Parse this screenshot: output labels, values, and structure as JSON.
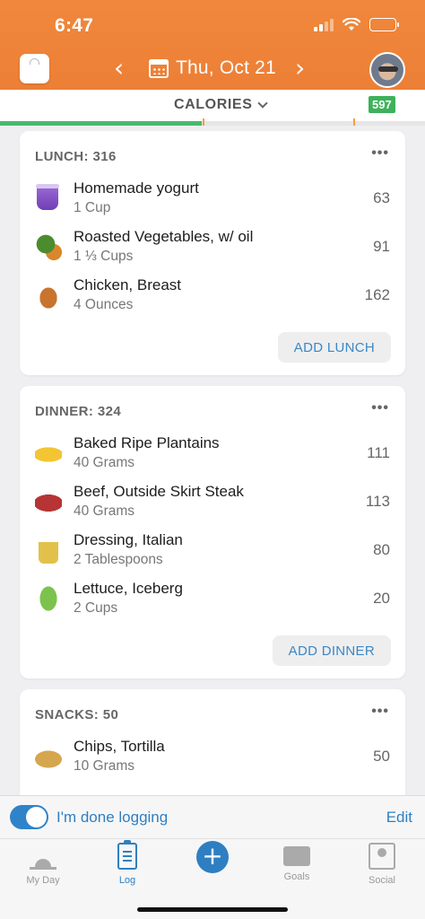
{
  "status_bar": {
    "time": "6:47"
  },
  "header": {
    "date": "Thu, Oct 21",
    "prev_arrow": "‹",
    "next_arrow": "›"
  },
  "metric": {
    "label": "CALORIES",
    "remaining": "597",
    "progress_fraction": 0.475,
    "accent": "#ec7f36",
    "progress_color": "#47b96c"
  },
  "meals": [
    {
      "title": "LUNCH: 316",
      "more": "•••",
      "add_label": "ADD LUNCH",
      "items": [
        {
          "name": "Homemade yogurt",
          "qty": "1 Cup",
          "cal": "63",
          "icon": "yogurt-icon"
        },
        {
          "name": "Roasted Vegetables, w/ oil",
          "qty": "1 ⅓ Cups",
          "cal": "91",
          "icon": "vegetables-icon"
        },
        {
          "name": "Chicken, Breast",
          "qty": "4 Ounces",
          "cal": "162",
          "icon": "chicken-icon"
        }
      ]
    },
    {
      "title": "DINNER: 324",
      "more": "•••",
      "add_label": "ADD DINNER",
      "items": [
        {
          "name": "Baked Ripe Plantains",
          "qty": "40 Grams",
          "cal": "111",
          "icon": "banana-icon"
        },
        {
          "name": "Beef, Outside Skirt Steak",
          "qty": "40 Grams",
          "cal": "113",
          "icon": "steak-icon"
        },
        {
          "name": "Dressing, Italian",
          "qty": "2 Tablespoons",
          "cal": "80",
          "icon": "oil-bottle-icon"
        },
        {
          "name": "Lettuce, Iceberg",
          "qty": "2 Cups",
          "cal": "20",
          "icon": "lettuce-icon"
        }
      ]
    },
    {
      "title": "SNACKS: 50",
      "more": "•••",
      "items": [
        {
          "name": "Chips, Tortilla",
          "qty": "10 Grams",
          "cal": "50",
          "icon": "chips-icon"
        }
      ]
    }
  ],
  "done_logging": {
    "label": "I'm done logging",
    "edit": "Edit",
    "enabled": true
  },
  "tabs": [
    {
      "label": "My Day",
      "icon": "sun-icon"
    },
    {
      "label": "Log",
      "icon": "clipboard-icon",
      "active": true
    },
    {
      "label": "",
      "icon": "plus-icon"
    },
    {
      "label": "Goals",
      "icon": "goals-icon"
    },
    {
      "label": "Social",
      "icon": "social-icon"
    }
  ]
}
